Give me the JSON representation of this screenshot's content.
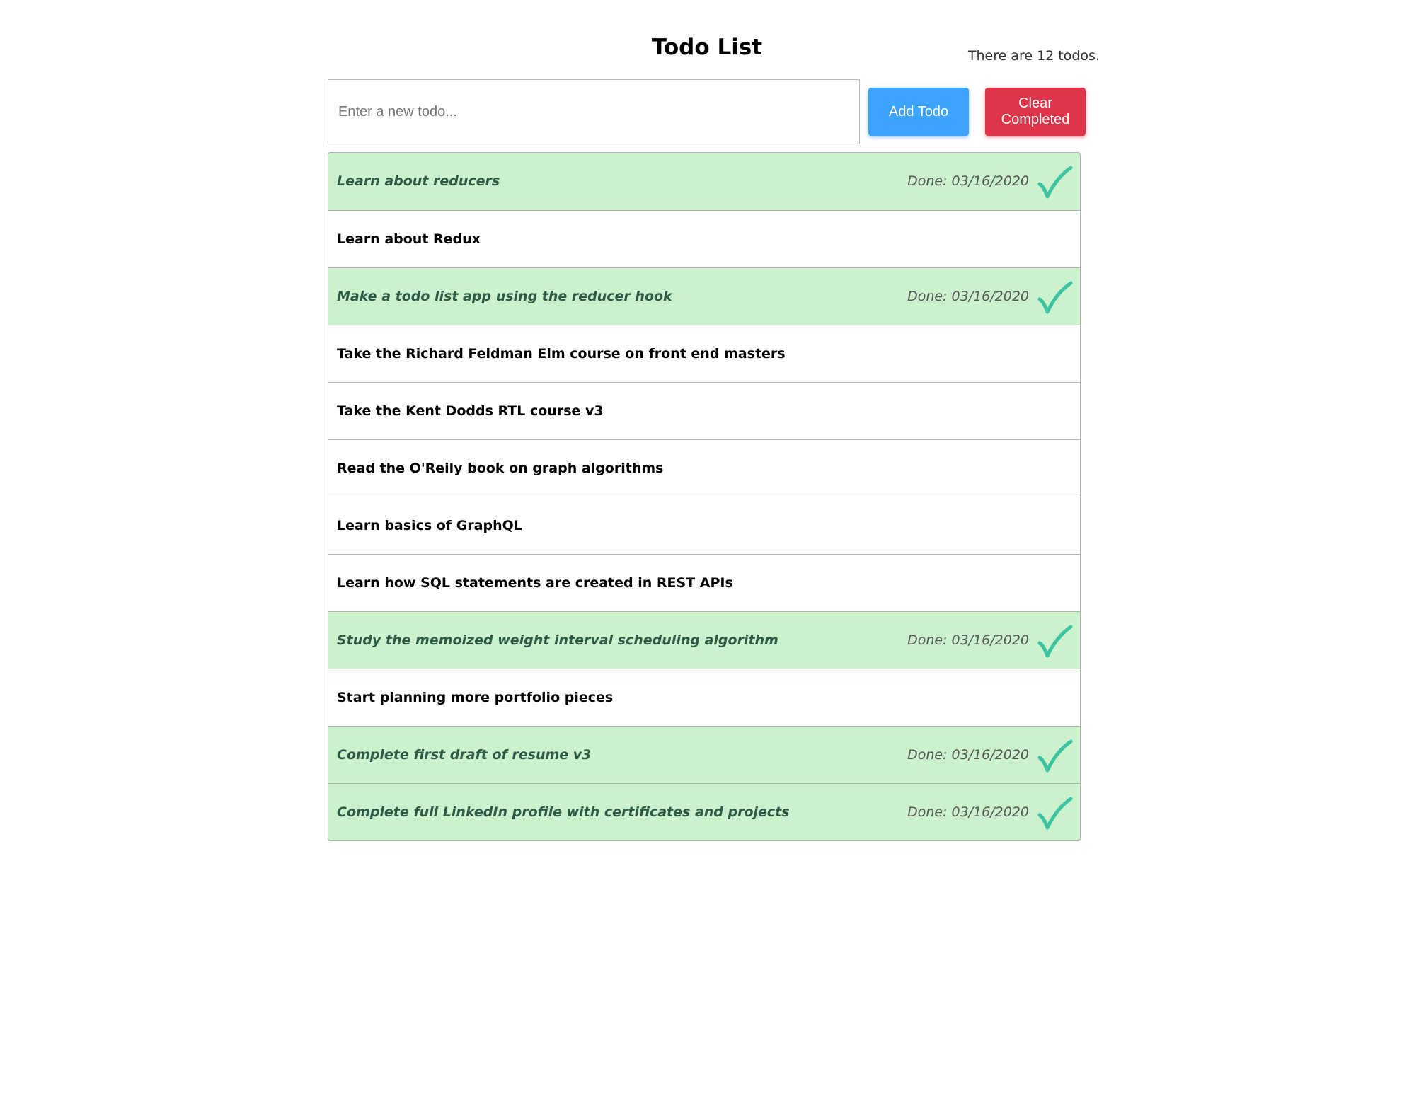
{
  "header": {
    "title": "Todo List",
    "count_text": "There are 12 todos."
  },
  "form": {
    "input_placeholder": "Enter a new todo...",
    "input_value": "",
    "add_label": "Add Todo",
    "clear_label": "Clear Completed"
  },
  "colors": {
    "add_button": "#3da3fc",
    "clear_button": "#e03448",
    "done_row": "#cbf2cc",
    "check": "#3cc4a2"
  },
  "todos": [
    {
      "text": "Learn about reducers",
      "done": true,
      "done_text": "Done: 03/16/2020"
    },
    {
      "text": "Learn about Redux",
      "done": false,
      "done_text": ""
    },
    {
      "text": "Make a todo list app using the reducer hook",
      "done": true,
      "done_text": "Done: 03/16/2020"
    },
    {
      "text": "Take the Richard Feldman Elm course on front end masters",
      "done": false,
      "done_text": ""
    },
    {
      "text": "Take the Kent Dodds RTL course v3",
      "done": false,
      "done_text": ""
    },
    {
      "text": "Read the O'Reily book on graph algorithms",
      "done": false,
      "done_text": ""
    },
    {
      "text": "Learn basics of GraphQL",
      "done": false,
      "done_text": ""
    },
    {
      "text": "Learn how SQL statements are created in REST APIs",
      "done": false,
      "done_text": ""
    },
    {
      "text": "Study the memoized weight interval scheduling algorithm",
      "done": true,
      "done_text": "Done: 03/16/2020"
    },
    {
      "text": "Start planning more portfolio pieces",
      "done": false,
      "done_text": ""
    },
    {
      "text": "Complete first draft of resume v3",
      "done": true,
      "done_text": "Done: 03/16/2020"
    },
    {
      "text": "Complete full LinkedIn profile with certificates and projects",
      "done": true,
      "done_text": "Done: 03/16/2020"
    }
  ]
}
